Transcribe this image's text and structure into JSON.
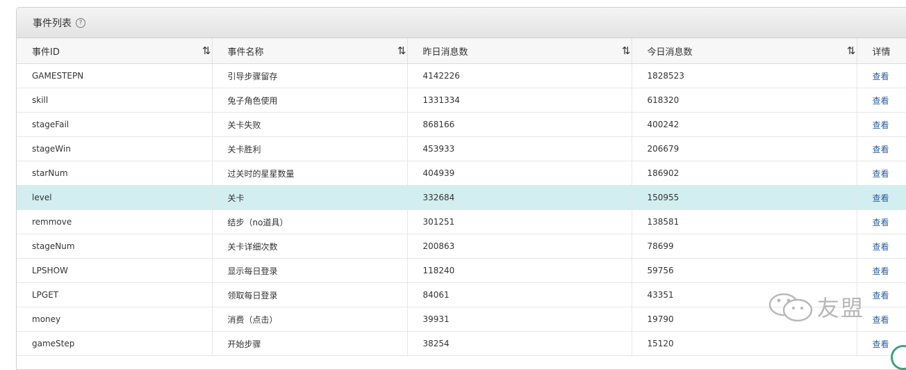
{
  "panel": {
    "title": "事件列表",
    "help_icon": "?"
  },
  "table": {
    "headers": {
      "event_id": "事件ID",
      "event_name": "事件名称",
      "yesterday_count": "昨日消息数",
      "today_count": "今日消息数",
      "detail": "详情"
    },
    "sort_icon_glyph": "⇅",
    "rows": [
      {
        "id": "GAMESTEPN",
        "name": "引导步骤留存",
        "yesterday": "4142226",
        "today": "1828523",
        "detail": "查看"
      },
      {
        "id": "skill",
        "name": "兔子角色使用",
        "yesterday": "1331334",
        "today": "618320",
        "detail": "查看"
      },
      {
        "id": "stageFail",
        "name": "关卡失败",
        "yesterday": "868166",
        "today": "400242",
        "detail": "查看"
      },
      {
        "id": "stageWin",
        "name": "关卡胜利",
        "yesterday": "453933",
        "today": "206679",
        "detail": "查看"
      },
      {
        "id": "starNum",
        "name": "过关时的星星数量",
        "yesterday": "404939",
        "today": "186902",
        "detail": "查看"
      },
      {
        "id": "level",
        "name": "关卡",
        "yesterday": "332684",
        "today": "150955",
        "detail": "查看",
        "highlighted": true
      },
      {
        "id": "remmove",
        "name": "结步（no道具）",
        "yesterday": "301251",
        "today": "138581",
        "detail": "查看"
      },
      {
        "id": "stageNum",
        "name": "关卡详细次数",
        "yesterday": "200863",
        "today": "78699",
        "detail": "查看"
      },
      {
        "id": "LPSHOW",
        "name": "显示每日登录",
        "yesterday": "118240",
        "today": "59756",
        "detail": "查看"
      },
      {
        "id": "LPGET",
        "name": "领取每日登录",
        "yesterday": "84061",
        "today": "43351",
        "detail": "查看"
      },
      {
        "id": "money",
        "name": "消费（点击）",
        "yesterday": "39931",
        "today": "19790",
        "detail": "查看"
      },
      {
        "id": "gameStep",
        "name": "开始步骤",
        "yesterday": "38254",
        "today": "15120",
        "detail": "查看"
      }
    ]
  },
  "watermark": {
    "text": "友盟",
    "icon": "wechat-icon",
    "color": "#b8b8b8"
  },
  "colors": {
    "highlight_row": "#d2eef0",
    "link": "#2a5e9e",
    "header_bg": "#f7f7f7"
  }
}
